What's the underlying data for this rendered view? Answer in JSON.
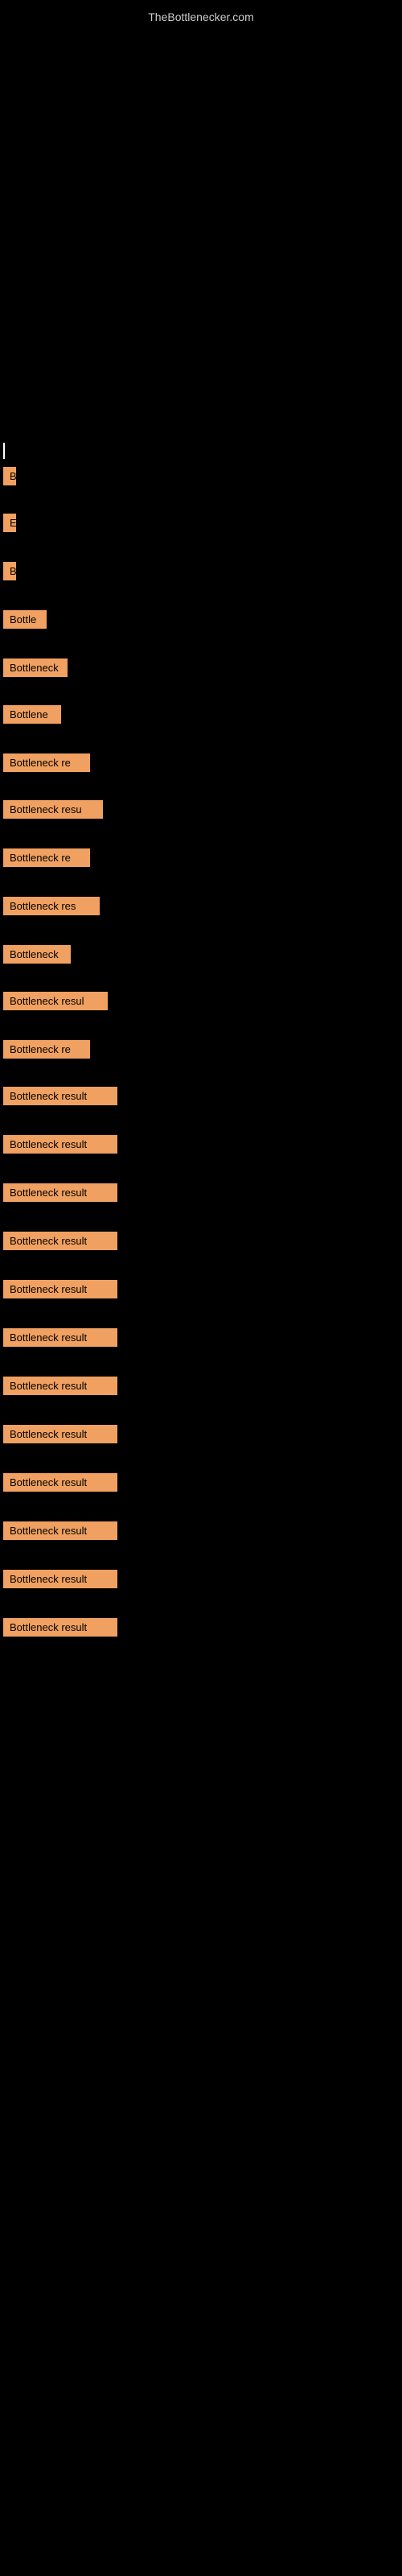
{
  "site": {
    "title": "TheBottlenecker.com"
  },
  "items": [
    {
      "id": 1,
      "label": "B",
      "width_class": "item-b1"
    },
    {
      "id": 2,
      "label": "E",
      "width_class": "item-b2"
    },
    {
      "id": 3,
      "label": "B",
      "width_class": "item-b3"
    },
    {
      "id": 4,
      "label": "Bottle",
      "width_class": "item-b4"
    },
    {
      "id": 5,
      "label": "Bottleneck",
      "width_class": "item-b5"
    },
    {
      "id": 6,
      "label": "Bottlene",
      "width_class": "item-b6"
    },
    {
      "id": 7,
      "label": "Bottleneck re",
      "width_class": "item-b7"
    },
    {
      "id": 8,
      "label": "Bottleneck resu",
      "width_class": "item-b8"
    },
    {
      "id": 9,
      "label": "Bottleneck re",
      "width_class": "item-b9"
    },
    {
      "id": 10,
      "label": "Bottleneck res",
      "width_class": "item-b10"
    },
    {
      "id": 11,
      "label": "Bottleneck",
      "width_class": "item-b11"
    },
    {
      "id": 12,
      "label": "Bottleneck resul",
      "width_class": "item-b12"
    },
    {
      "id": 13,
      "label": "Bottleneck re",
      "width_class": "item-b13"
    },
    {
      "id": 14,
      "label": "Bottleneck result",
      "width_class": "item-b14"
    },
    {
      "id": 15,
      "label": "Bottleneck result",
      "width_class": "item-b15"
    },
    {
      "id": 16,
      "label": "Bottleneck result",
      "width_class": "item-b16"
    },
    {
      "id": 17,
      "label": "Bottleneck result",
      "width_class": "item-b17"
    },
    {
      "id": 18,
      "label": "Bottleneck result",
      "width_class": "item-b18"
    },
    {
      "id": 19,
      "label": "Bottleneck result",
      "width_class": "item-b19"
    },
    {
      "id": 20,
      "label": "Bottleneck result",
      "width_class": "item-b20"
    },
    {
      "id": 21,
      "label": "Bottleneck result",
      "width_class": "item-b21"
    },
    {
      "id": 22,
      "label": "Bottleneck result",
      "width_class": "item-b22"
    },
    {
      "id": 23,
      "label": "Bottleneck result",
      "width_class": "item-b23"
    },
    {
      "id": 24,
      "label": "Bottleneck result",
      "width_class": "item-b24"
    },
    {
      "id": 25,
      "label": "Bottleneck result",
      "width_class": "item-b25"
    }
  ]
}
